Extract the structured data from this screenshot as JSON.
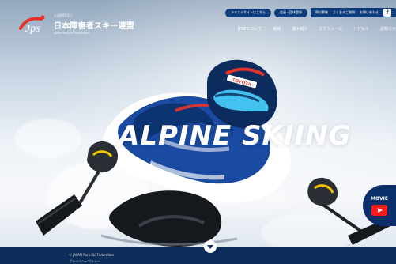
{
  "brand": {
    "jp_small": "公益財団法人",
    "name": "日本障害者スキー連盟",
    "en_small": "JAPAN Para-Ski Federation",
    "initials": "Jps"
  },
  "header": {
    "top_links": [
      "テキストサイトはこちら",
      "会員・団体登録",
      "寄付募集",
      "よくあるご質問",
      "お問い合わせ"
    ],
    "social": {
      "fb_icon": "facebook-icon",
      "fb_label": "f"
    },
    "nav": [
      "JPSFについて",
      "競技",
      "選手紹介",
      "スケジュール",
      "リザルト",
      "お知らせ"
    ]
  },
  "hero": {
    "title": "ALPINE SKIING",
    "helmet_brand": "TOYOTA"
  },
  "movie": {
    "label": "MOVIE"
  },
  "footer": {
    "copyright": "© JAPAN Para-Ski Federation",
    "privacy": "プライバシーポリシー"
  },
  "colors": {
    "navy": "#0f2d5a",
    "nav_pill": "#0f3c7a",
    "movie_red": "#ff1a1a",
    "logo_red": "#e5322d"
  }
}
